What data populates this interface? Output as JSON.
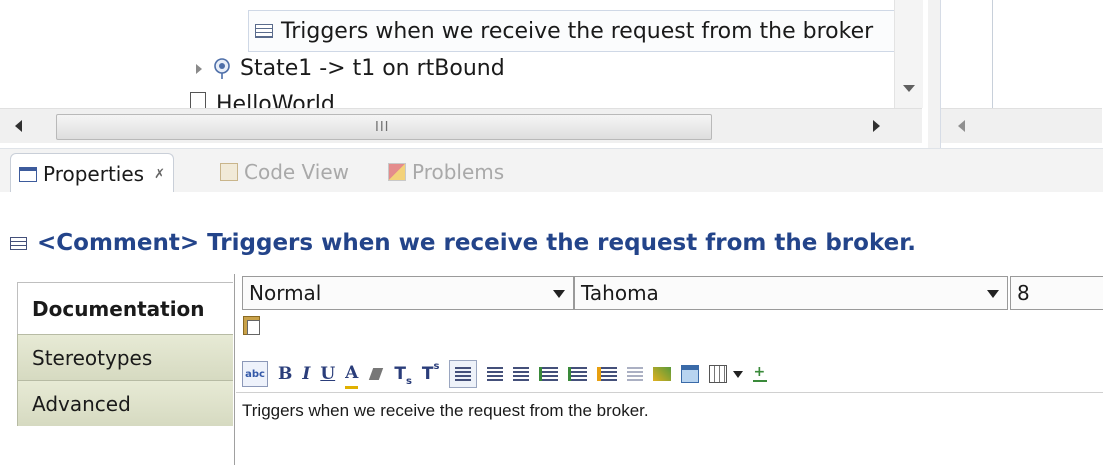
{
  "tree": {
    "selected_comment": "Triggers when we receive the request from the broker",
    "transition": "State1 -> t1 on rtBound",
    "partial_item": "HelloWorld",
    "hscroll_grip": "III"
  },
  "tabs": [
    {
      "label": "Properties",
      "close": "✗",
      "icon": "properties-icon"
    },
    {
      "label": "Code View",
      "icon": "code-view-icon"
    },
    {
      "label": "Problems",
      "icon": "problems-icon"
    }
  ],
  "properties": {
    "element_kind": "<Comment>",
    "element_text": "Triggers when we receive the request from the broker."
  },
  "side_tabs": [
    {
      "label": "Documentation",
      "active": true
    },
    {
      "label": "Stereotypes",
      "active": false
    },
    {
      "label": "Advanced",
      "active": false
    }
  ],
  "editor": {
    "style_select": "Normal",
    "font_select": "Tahoma",
    "size_select": "8",
    "toolbar": {
      "spell": "abc",
      "bold": "B",
      "italic": "I",
      "underline": "U",
      "font_color": "A",
      "subscript": "T",
      "superscript": "T"
    },
    "content": "Triggers when we receive the request from the broker."
  },
  "colors": {
    "header_text": "#23448a",
    "side_tab_bg": "#d9dcc5"
  }
}
